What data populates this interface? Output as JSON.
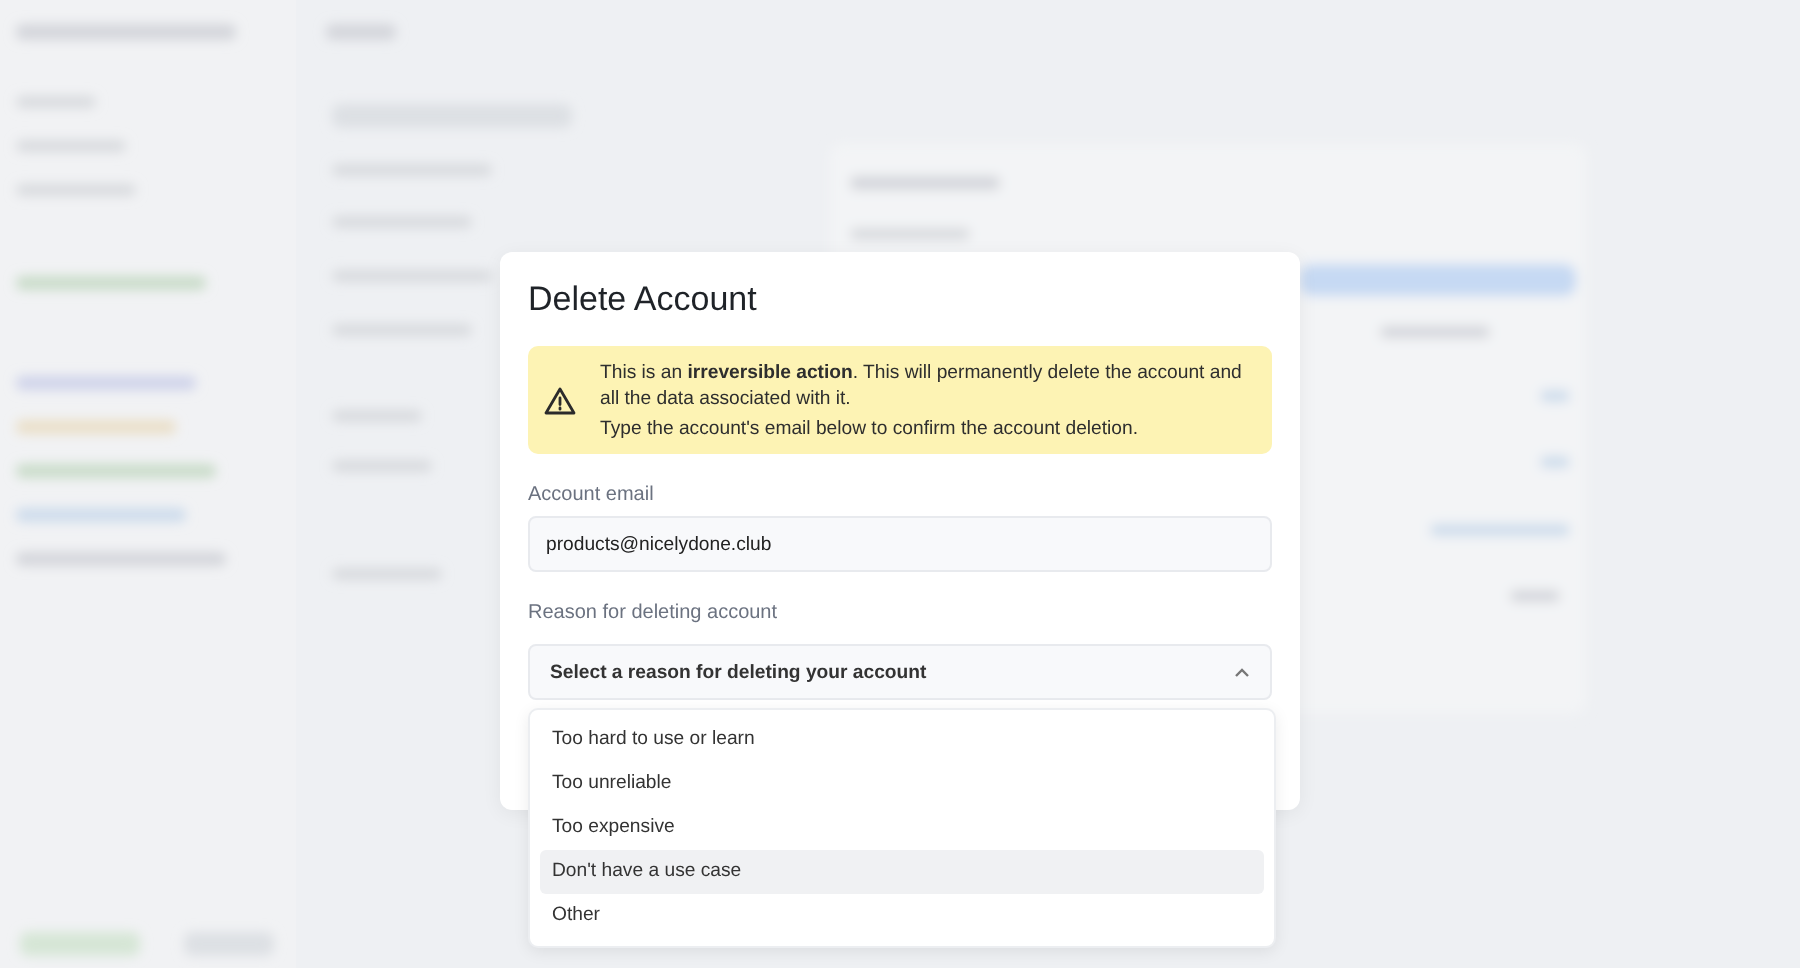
{
  "dialog": {
    "title": "Delete Account",
    "alert": {
      "lines": [
        "This is an **irreversible action**. This will permanently delete the account and all the data associated with it.",
        "Type the account's email below to confirm the account deletion."
      ]
    },
    "email_field": {
      "label": "Account email",
      "value": "products@nicelydone.club"
    },
    "reason_field": {
      "label": "Reason for deleting account",
      "placeholder": "Select a reason for deleting your account",
      "expanded": true,
      "options": [
        {
          "label": "Too hard to use or learn",
          "selected": false
        },
        {
          "label": "Too unreliable",
          "selected": false
        },
        {
          "label": "Too expensive",
          "selected": false
        },
        {
          "label": "Don't have a use case",
          "selected": true
        },
        {
          "label": "Other",
          "selected": false
        }
      ]
    }
  }
}
